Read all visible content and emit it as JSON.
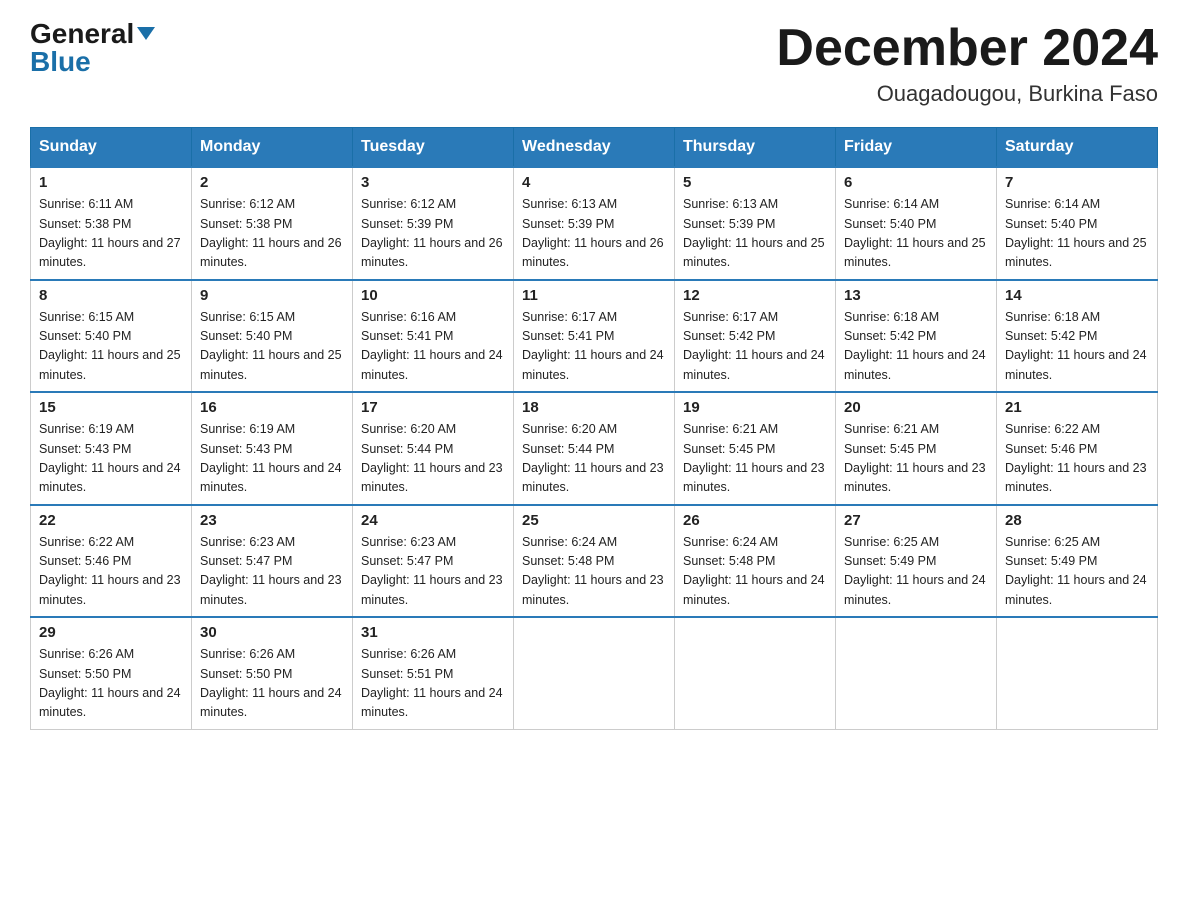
{
  "header": {
    "logo_general": "General",
    "logo_blue": "Blue",
    "month_title": "December 2024",
    "location": "Ouagadougou, Burkina Faso"
  },
  "days_of_week": [
    "Sunday",
    "Monday",
    "Tuesday",
    "Wednesday",
    "Thursday",
    "Friday",
    "Saturday"
  ],
  "weeks": [
    [
      {
        "day": "1",
        "sunrise": "6:11 AM",
        "sunset": "5:38 PM",
        "daylight": "11 hours and 27 minutes."
      },
      {
        "day": "2",
        "sunrise": "6:12 AM",
        "sunset": "5:38 PM",
        "daylight": "11 hours and 26 minutes."
      },
      {
        "day": "3",
        "sunrise": "6:12 AM",
        "sunset": "5:39 PM",
        "daylight": "11 hours and 26 minutes."
      },
      {
        "day": "4",
        "sunrise": "6:13 AM",
        "sunset": "5:39 PM",
        "daylight": "11 hours and 26 minutes."
      },
      {
        "day": "5",
        "sunrise": "6:13 AM",
        "sunset": "5:39 PM",
        "daylight": "11 hours and 25 minutes."
      },
      {
        "day": "6",
        "sunrise": "6:14 AM",
        "sunset": "5:40 PM",
        "daylight": "11 hours and 25 minutes."
      },
      {
        "day": "7",
        "sunrise": "6:14 AM",
        "sunset": "5:40 PM",
        "daylight": "11 hours and 25 minutes."
      }
    ],
    [
      {
        "day": "8",
        "sunrise": "6:15 AM",
        "sunset": "5:40 PM",
        "daylight": "11 hours and 25 minutes."
      },
      {
        "day": "9",
        "sunrise": "6:15 AM",
        "sunset": "5:40 PM",
        "daylight": "11 hours and 25 minutes."
      },
      {
        "day": "10",
        "sunrise": "6:16 AM",
        "sunset": "5:41 PM",
        "daylight": "11 hours and 24 minutes."
      },
      {
        "day": "11",
        "sunrise": "6:17 AM",
        "sunset": "5:41 PM",
        "daylight": "11 hours and 24 minutes."
      },
      {
        "day": "12",
        "sunrise": "6:17 AM",
        "sunset": "5:42 PM",
        "daylight": "11 hours and 24 minutes."
      },
      {
        "day": "13",
        "sunrise": "6:18 AM",
        "sunset": "5:42 PM",
        "daylight": "11 hours and 24 minutes."
      },
      {
        "day": "14",
        "sunrise": "6:18 AM",
        "sunset": "5:42 PM",
        "daylight": "11 hours and 24 minutes."
      }
    ],
    [
      {
        "day": "15",
        "sunrise": "6:19 AM",
        "sunset": "5:43 PM",
        "daylight": "11 hours and 24 minutes."
      },
      {
        "day": "16",
        "sunrise": "6:19 AM",
        "sunset": "5:43 PM",
        "daylight": "11 hours and 24 minutes."
      },
      {
        "day": "17",
        "sunrise": "6:20 AM",
        "sunset": "5:44 PM",
        "daylight": "11 hours and 23 minutes."
      },
      {
        "day": "18",
        "sunrise": "6:20 AM",
        "sunset": "5:44 PM",
        "daylight": "11 hours and 23 minutes."
      },
      {
        "day": "19",
        "sunrise": "6:21 AM",
        "sunset": "5:45 PM",
        "daylight": "11 hours and 23 minutes."
      },
      {
        "day": "20",
        "sunrise": "6:21 AM",
        "sunset": "5:45 PM",
        "daylight": "11 hours and 23 minutes."
      },
      {
        "day": "21",
        "sunrise": "6:22 AM",
        "sunset": "5:46 PM",
        "daylight": "11 hours and 23 minutes."
      }
    ],
    [
      {
        "day": "22",
        "sunrise": "6:22 AM",
        "sunset": "5:46 PM",
        "daylight": "11 hours and 23 minutes."
      },
      {
        "day": "23",
        "sunrise": "6:23 AM",
        "sunset": "5:47 PM",
        "daylight": "11 hours and 23 minutes."
      },
      {
        "day": "24",
        "sunrise": "6:23 AM",
        "sunset": "5:47 PM",
        "daylight": "11 hours and 23 minutes."
      },
      {
        "day": "25",
        "sunrise": "6:24 AM",
        "sunset": "5:48 PM",
        "daylight": "11 hours and 23 minutes."
      },
      {
        "day": "26",
        "sunrise": "6:24 AM",
        "sunset": "5:48 PM",
        "daylight": "11 hours and 24 minutes."
      },
      {
        "day": "27",
        "sunrise": "6:25 AM",
        "sunset": "5:49 PM",
        "daylight": "11 hours and 24 minutes."
      },
      {
        "day": "28",
        "sunrise": "6:25 AM",
        "sunset": "5:49 PM",
        "daylight": "11 hours and 24 minutes."
      }
    ],
    [
      {
        "day": "29",
        "sunrise": "6:26 AM",
        "sunset": "5:50 PM",
        "daylight": "11 hours and 24 minutes."
      },
      {
        "day": "30",
        "sunrise": "6:26 AM",
        "sunset": "5:50 PM",
        "daylight": "11 hours and 24 minutes."
      },
      {
        "day": "31",
        "sunrise": "6:26 AM",
        "sunset": "5:51 PM",
        "daylight": "11 hours and 24 minutes."
      },
      null,
      null,
      null,
      null
    ]
  ],
  "labels": {
    "sunrise_prefix": "Sunrise: ",
    "sunset_prefix": "Sunset: ",
    "daylight_prefix": "Daylight: "
  }
}
